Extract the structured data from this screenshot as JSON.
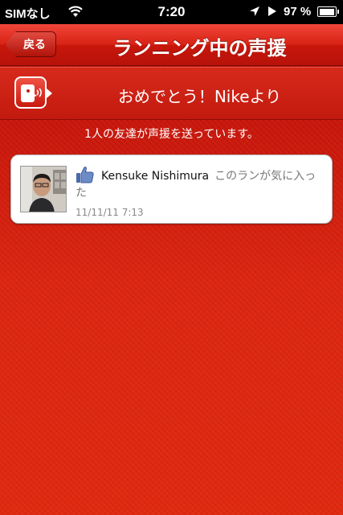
{
  "status_bar": {
    "carrier": "SIMなし",
    "time": "7:20",
    "battery": "97 %",
    "battery_level": 0.97
  },
  "nav": {
    "back_label": "戻る",
    "title": "ランニング中の声援"
  },
  "cheer": {
    "title": "おめでとう！Nikeより"
  },
  "friends_count_text": "1人の友達が声援を送っています。",
  "cheers": [
    {
      "name": "Kensuke Nishimura",
      "message": "このランが気に入った",
      "timestamp": "11/11/11  7:13"
    }
  ],
  "icons": {
    "wifi": "wifi-icon",
    "location": "location-arrow-icon",
    "play": "play-icon",
    "battery": "battery-icon",
    "cheer": "cheer-speech-icon",
    "like": "facebook-like-icon"
  },
  "colors": {
    "accent": "#d41e0c",
    "nav_red": "#c8170c",
    "facebook_blue": "#4a6aa8"
  }
}
